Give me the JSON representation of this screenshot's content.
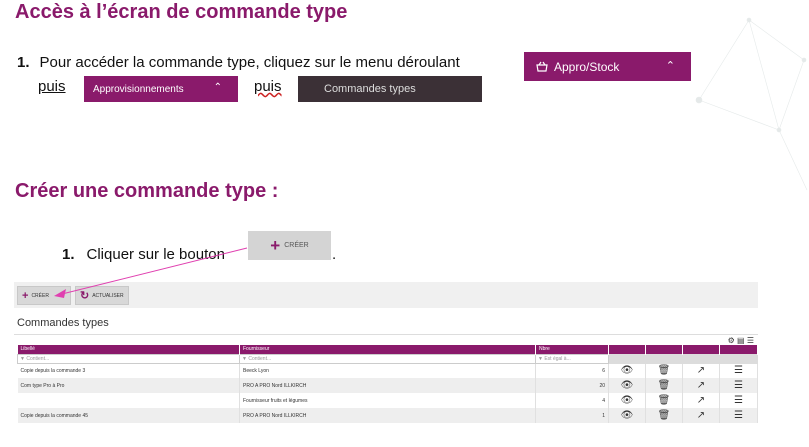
{
  "heading_access": "Accès à l’écran de commande type",
  "step1": {
    "number": "1.",
    "text": "Pour accéder la commande type, cliquez sur le menu déroulant",
    "puis_1": "puis",
    "puis_2": "puis",
    "menu_appro": "Appro/Stock",
    "menu_approvisionnements": "Approvisionnements",
    "menu_commandes_types": "Commandes types"
  },
  "heading_create": "Créer une commande type :",
  "step2": {
    "number": "1.",
    "text": "Cliquer sur le bouton",
    "end": ".",
    "button_label": "CRÉER"
  },
  "screenshot": {
    "btn_creer": "CRÉER",
    "btn_actualiser": "ACTUALISER",
    "title": "Commandes types",
    "columns": [
      "Libellé",
      "Fournisseur",
      "Nbre"
    ],
    "filters": [
      "▼ Contient...",
      "▼ Contient...",
      "▼ Est égal à..."
    ],
    "rows": [
      {
        "libelle": "Copie depuis la commande 3",
        "fournisseur": "Beeck Lyon",
        "nbre": "6"
      },
      {
        "libelle": "Com type Pro à Pro",
        "fournisseur": "PRO A PRO Nord ILLKIRCH",
        "nbre": "20"
      },
      {
        "libelle": "",
        "fournisseur": "Fournisseur fruits et légumes",
        "nbre": "4"
      },
      {
        "libelle": "Copie depuis la commande 45",
        "fournisseur": "PRO A PRO Nord ILLKIRCH",
        "nbre": "1"
      }
    ]
  },
  "colors": {
    "brand": "#8a1a6b",
    "dark_menu": "#3b3036",
    "arrow": "#e040b0"
  },
  "icons": [
    "basket-icon",
    "chevron-up-icon",
    "plus-icon",
    "refresh-icon",
    "eye-icon",
    "trash-icon",
    "external-link-icon",
    "menu-icon",
    "gear-icon"
  ]
}
